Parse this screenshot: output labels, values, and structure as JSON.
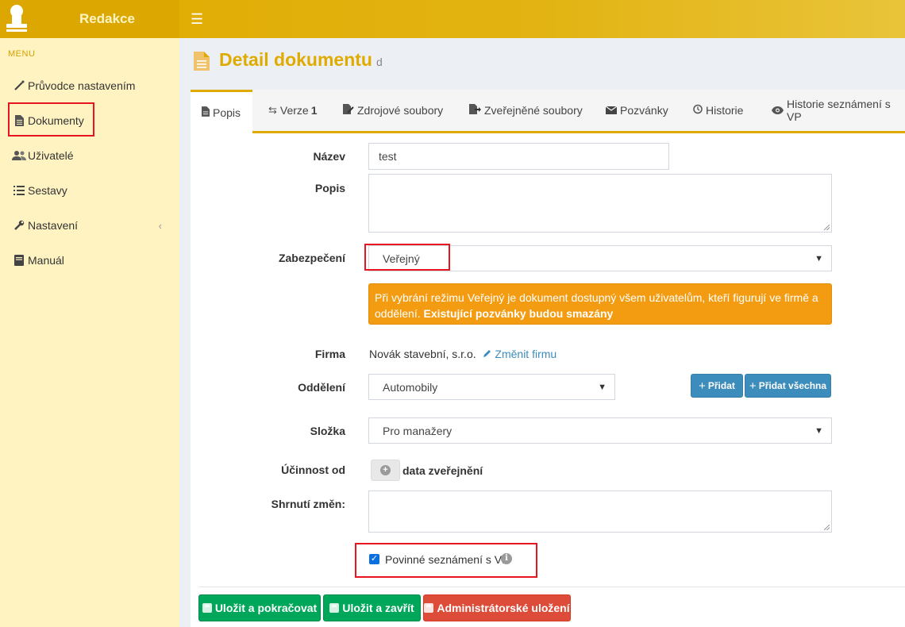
{
  "app": {
    "title": "Redakce"
  },
  "sidebar": {
    "header": "MENU",
    "items": [
      {
        "label": "Průvodce nastavením",
        "icon": "wand-icon"
      },
      {
        "label": "Dokumenty",
        "icon": "document-icon"
      },
      {
        "label": "Uživatelé",
        "icon": "users-icon"
      },
      {
        "label": "Sestavy",
        "icon": "list-icon"
      },
      {
        "label": "Nastavení",
        "icon": "wrench-icon"
      },
      {
        "label": "Manuál",
        "icon": "book-icon"
      }
    ]
  },
  "page": {
    "title": "Detail dokumentu",
    "subtitle": "d"
  },
  "tabs": [
    {
      "label": "Popis",
      "icon": "document-icon"
    },
    {
      "label": "Verze",
      "badge": "1",
      "icon": "versions-icon"
    },
    {
      "label": "Zdrojové soubory",
      "icon": "file-edit-icon"
    },
    {
      "label": "Zveřejněné soubory",
      "icon": "file-export-icon"
    },
    {
      "label": "Pozvánky",
      "icon": "envelope-icon"
    },
    {
      "label": "Historie",
      "icon": "history-icon"
    },
    {
      "label": "Historie seznámení s VP",
      "icon": "eye-icon"
    }
  ],
  "form": {
    "nazev_label": "Název",
    "nazev_value": "test",
    "popis_label": "Popis",
    "zabezpeceni_label": "Zabezpečení",
    "zabezpeceni_value": "Veřejný",
    "warning_text": "Při vybrání režimu Veřejný je dokument dostupný všem uživatelům, kteří figurují ve firmě a oddělení.",
    "warning_bold": "Existující pozvánky budou smazány",
    "firma_label": "Firma",
    "firma_value": "Novák stavební, s.r.o.",
    "firma_link": "Změnit firmu",
    "oddeleni_label": "Oddělení",
    "oddeleni_value": "Automobily",
    "add_label": "Přidat",
    "add_all_label": "Přidat všechna",
    "slozka_label": "Složka",
    "slozka_value": "Pro manažery",
    "ucinnost_label": "Účinnost od",
    "ucinnost_text": "data zveřejnění",
    "shrnuti_label": "Shrnutí změn:",
    "povinne_label": "Povinné seznámení s VP",
    "povinne_checked": true
  },
  "buttons": {
    "save_continue": "Uložit a pokračovat",
    "save_close": "Uložit a zavřít",
    "admin_save": "Administrátorské uložení"
  }
}
